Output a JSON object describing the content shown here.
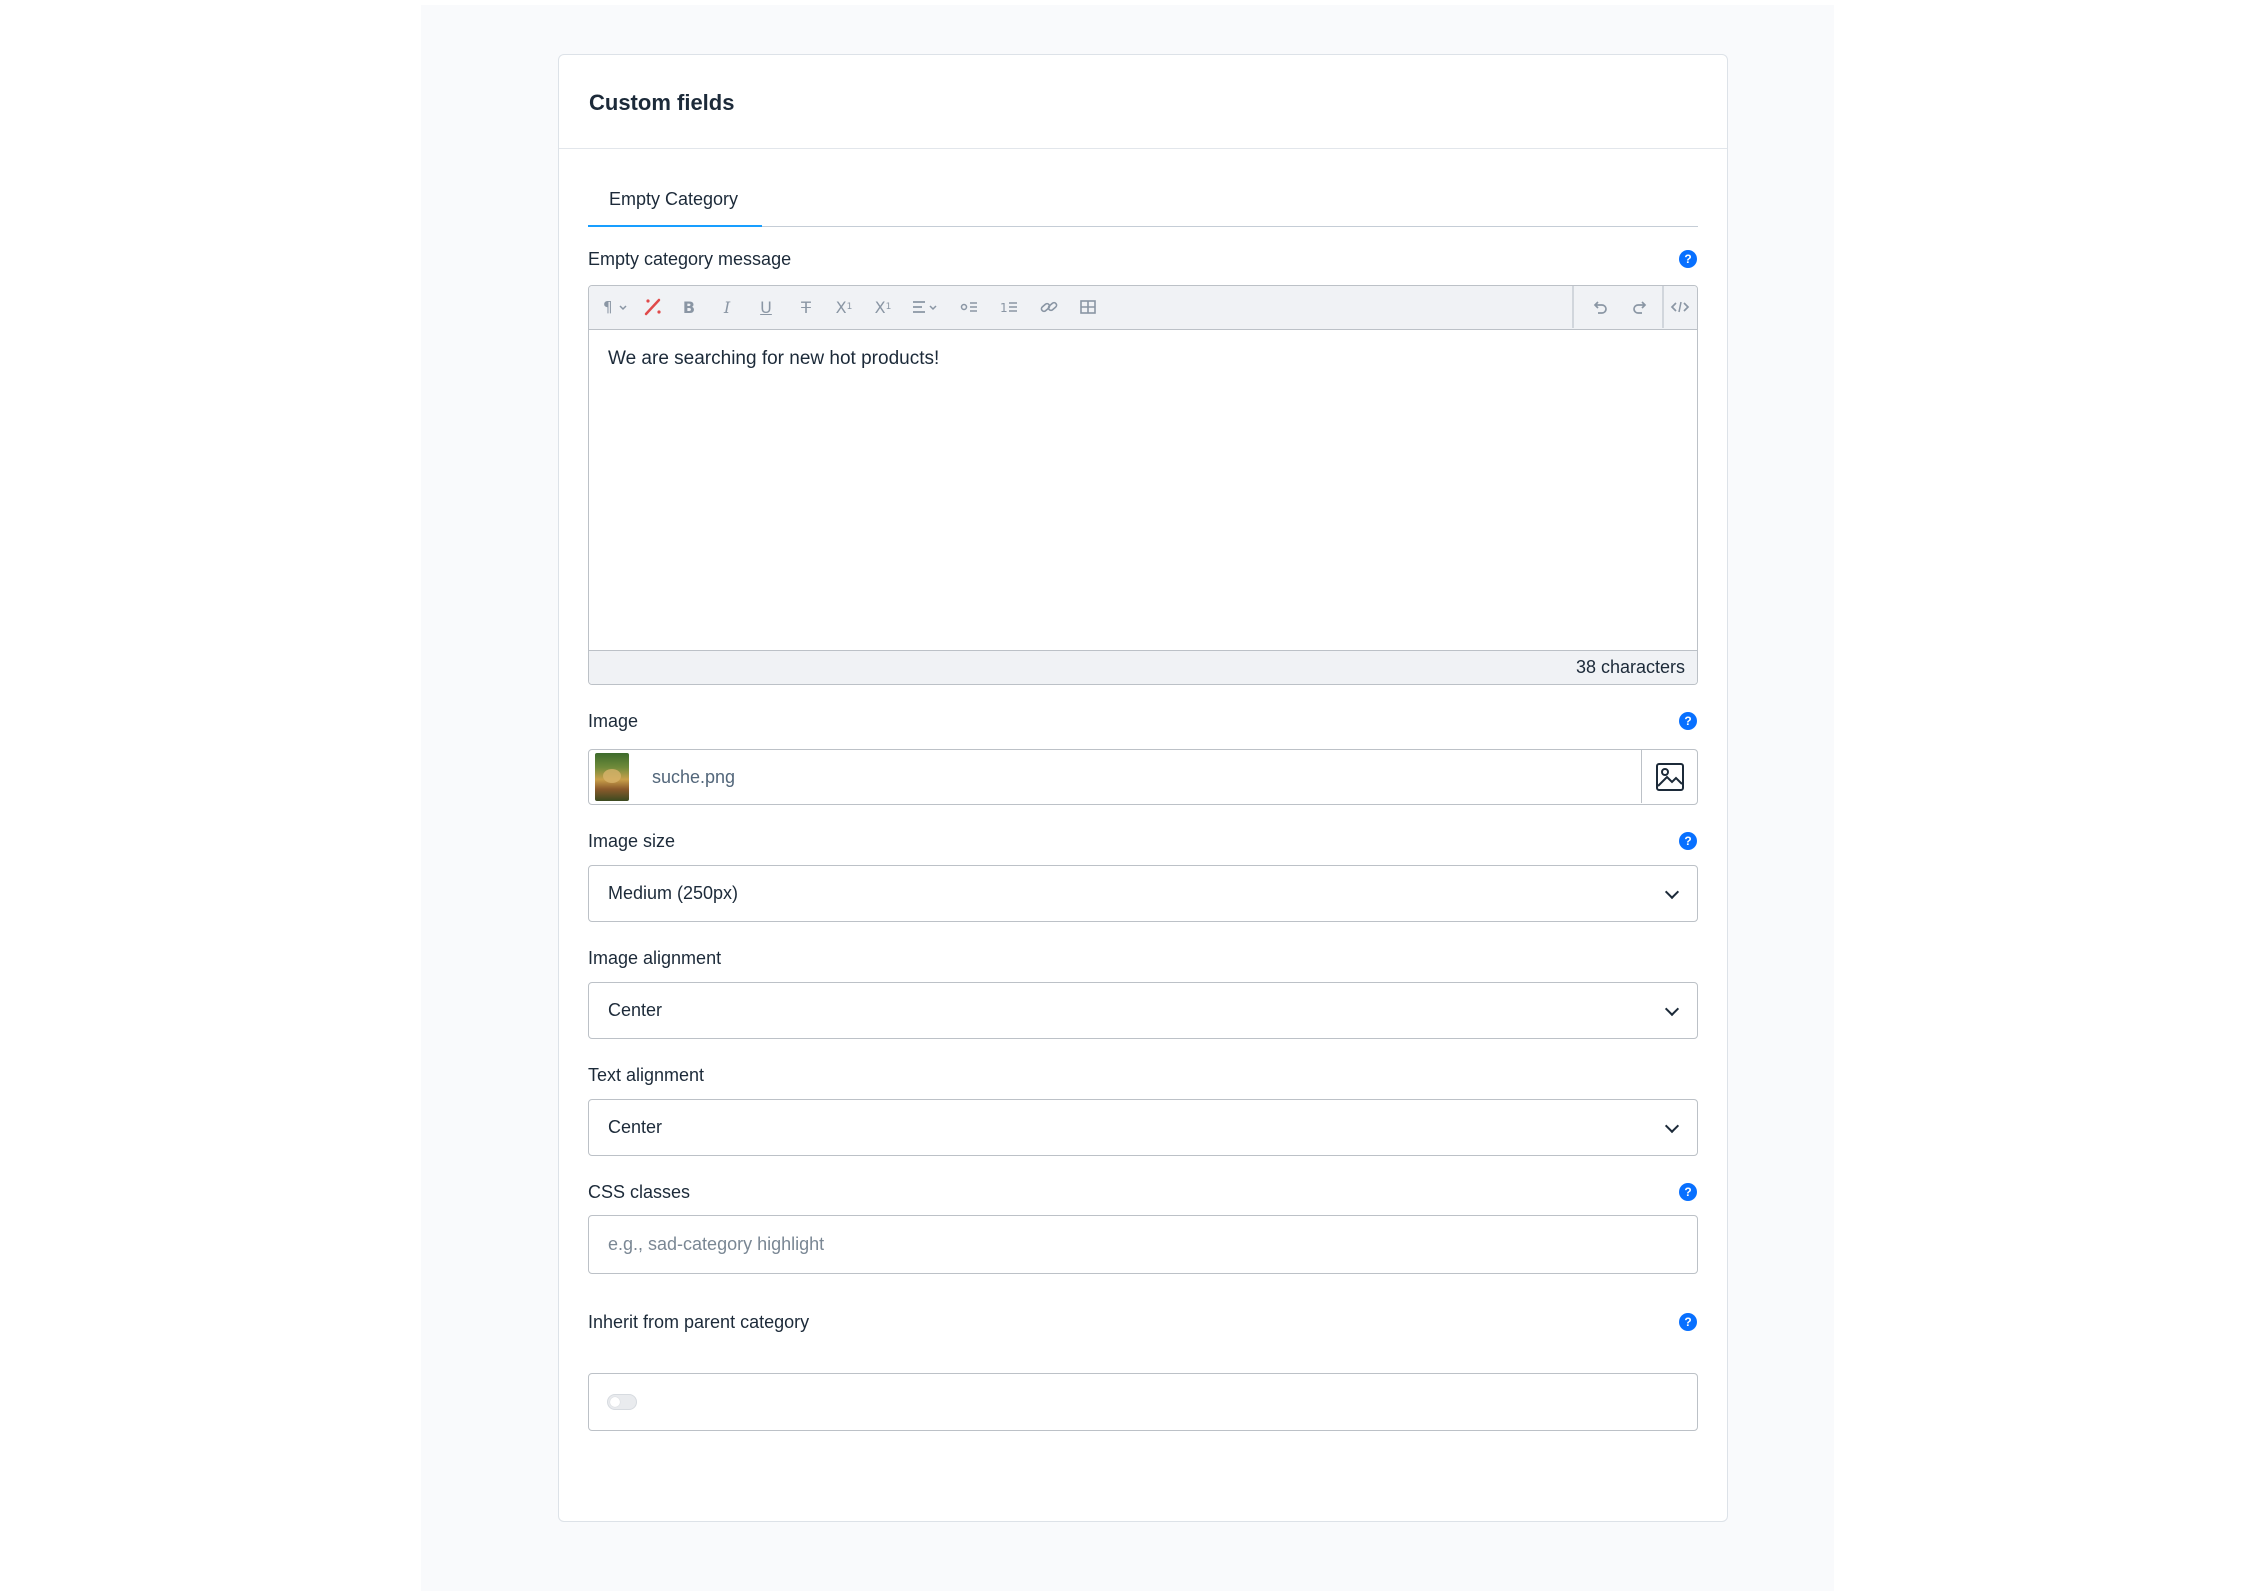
{
  "card": {
    "title": "Custom fields"
  },
  "tabs": [
    {
      "label": "Empty Category",
      "active": true
    }
  ],
  "fields": {
    "message": {
      "label": "Empty category message",
      "content": "We are searching for new hot products!",
      "char_count": "38 characters"
    },
    "image": {
      "label": "Image",
      "file_name": "suche.png"
    },
    "image_size": {
      "label": "Image size",
      "value": "Medium (250px)"
    },
    "image_alignment": {
      "label": "Image alignment",
      "value": "Center"
    },
    "text_alignment": {
      "label": "Text alignment",
      "value": "Center"
    },
    "css_classes": {
      "label": "CSS classes",
      "value": "",
      "placeholder": "e.g., sad-category highlight"
    },
    "inherit": {
      "label": "Inherit from parent category",
      "enabled": false
    }
  },
  "toolbar_icons": [
    "paragraph-format-icon",
    "remove-format-icon",
    "bold-icon",
    "italic-icon",
    "underline-icon",
    "strikethrough-icon",
    "superscript-icon",
    "subscript-icon",
    "text-align-icon",
    "unordered-list-icon",
    "ordered-list-icon",
    "link-icon",
    "table-icon",
    "undo-icon",
    "redo-icon",
    "code-view-icon"
  ],
  "colors": {
    "accent": "#189eff",
    "help_icon": "#0870ff",
    "text": "#1c2a39",
    "border": "#bcc1c7"
  }
}
